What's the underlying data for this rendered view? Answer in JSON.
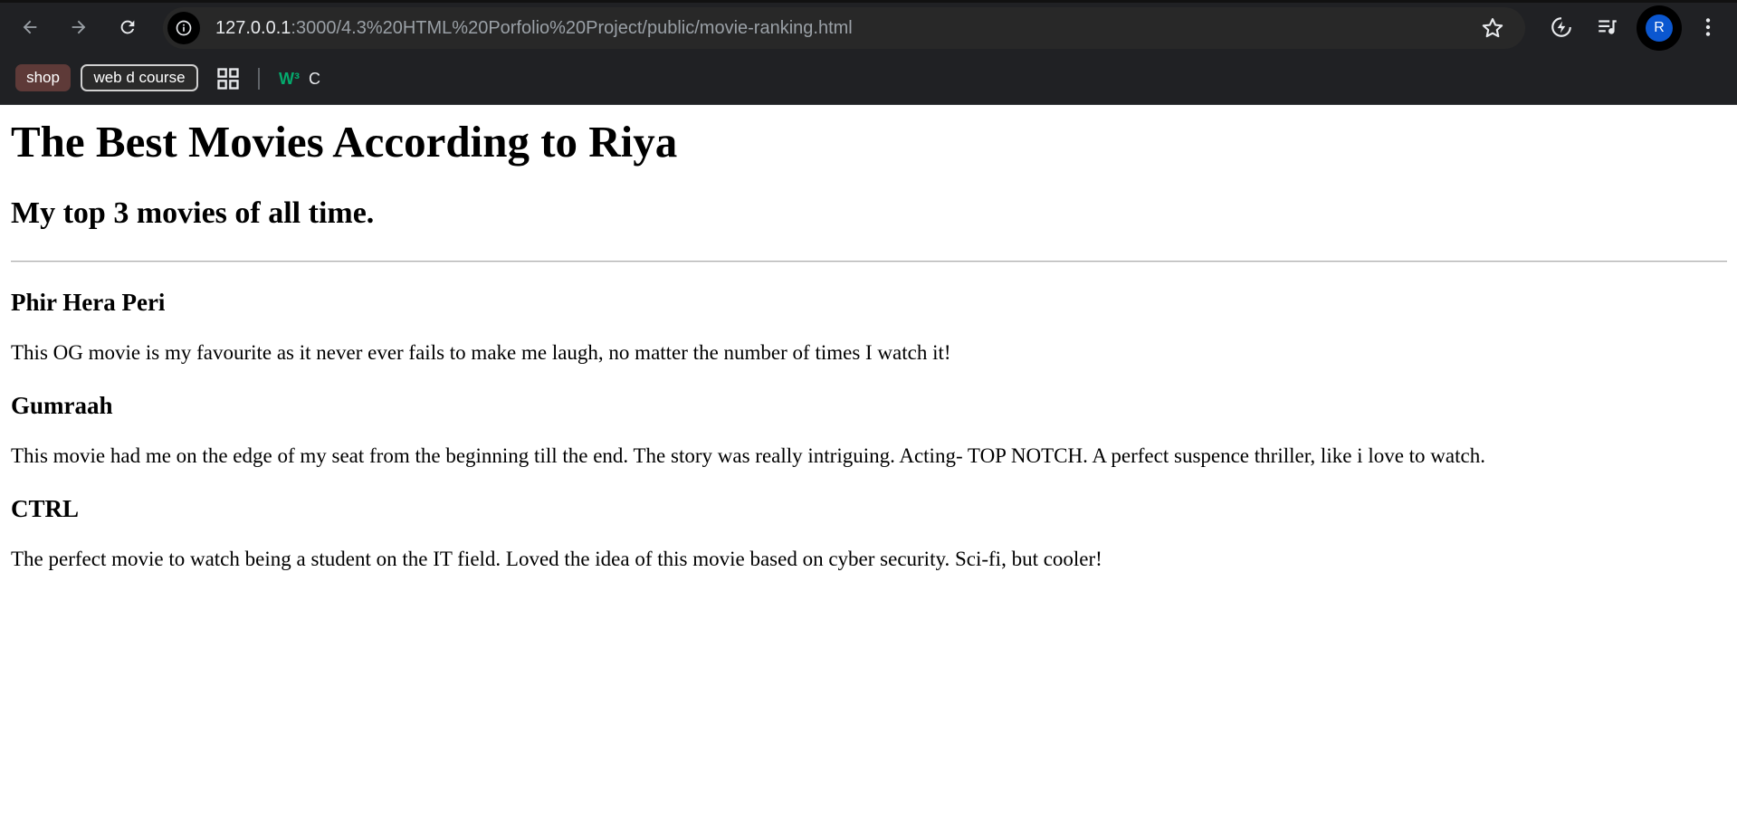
{
  "browser": {
    "url_host": "127.0.0.1",
    "url_path": ":3000/4.3%20HTML%20Porfolio%20Project/public/movie-ranking.html",
    "avatar_letter": "R",
    "bookmarks": [
      {
        "label": "shop"
      },
      {
        "label": "web d course"
      }
    ],
    "w3_label": "C",
    "colors": {
      "toolbar_bg": "#202124",
      "omnibox_bg": "#282828",
      "avatar_bg": "#0b57d0",
      "shop_chip_bg": "#5e3a38",
      "w3_green": "#04aa6d"
    }
  },
  "page": {
    "title": "The Best Movies According to Riya",
    "subtitle": "My top 3 movies of all time.",
    "movies": [
      {
        "name": "Phir Hera Peri",
        "review": "This OG movie is my favourite as it never ever fails to make me laugh, no matter the number of times I watch it!"
      },
      {
        "name": "Gumraah",
        "review": "This movie had me on the edge of my seat from the beginning till the end. The story was really intriguing. Acting- TOP NOTCH. A perfect suspence thriller, like i love to watch."
      },
      {
        "name": "CTRL",
        "review": "The perfect movie to watch being a student on the IT field. Loved the idea of this movie based on cyber security. Sci-fi, but cooler!"
      }
    ]
  }
}
